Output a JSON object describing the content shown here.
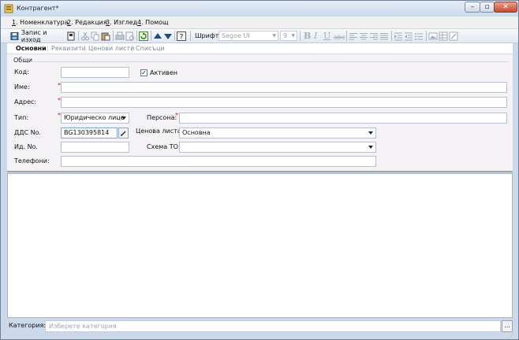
{
  "window": {
    "title": "Контрагент*",
    "controls": {
      "minimize": "–",
      "maximize": "▫",
      "close": "✕"
    }
  },
  "menu": [
    {
      "num": "1",
      "text": ". Номенклатура"
    },
    {
      "num": "2",
      "text": ". Редакция"
    },
    {
      "num": "3",
      "text": ". Изглед"
    },
    {
      "num": "4",
      "text": ". Помощ"
    }
  ],
  "toolbar": {
    "save_label": "Запис и изход",
    "font_label": "Шрифт:",
    "font_value": "Segoe UI",
    "size_value": "9",
    "format_glyphs": {
      "bold": "B",
      "italic": "I",
      "underline": "U",
      "strike": "abc"
    }
  },
  "tabs": [
    {
      "label": "Основни",
      "active": true
    },
    {
      "label": "Реквизити",
      "active": false
    },
    {
      "label": "Ценови листи",
      "active": false
    },
    {
      "label": "Списъци",
      "active": false
    }
  ],
  "form": {
    "group_title": "Общи",
    "code_label": "Код:",
    "code_value": "",
    "active_label": "Активен",
    "active_checked": true,
    "check_glyph": "✓",
    "name_label": "Име:",
    "name_value": "",
    "address_label": "Адрес:",
    "address_value": "",
    "type_label": "Тип:",
    "type_value": "Юридическо лице",
    "persona_label": "Персона:",
    "persona_value": "",
    "vat_label": "ДДС No.",
    "vat_value": "BG130395814",
    "price_list_label": "Ценова листа:",
    "price_list_value": "Основна",
    "id_label": "Ид. No.",
    "id_value": "",
    "scheme_label": "Схема ТО:",
    "scheme_value": "",
    "phones_label": "Телефони:",
    "phones_value": "",
    "required_mark": "*"
  },
  "bottom": {
    "category_label": "Категория:",
    "category_placeholder": "Изберете категория",
    "browse_label": "..."
  },
  "colors": {
    "accent": "#7fa7d6",
    "required": "#d01c1c",
    "close": "#c44a2e"
  }
}
